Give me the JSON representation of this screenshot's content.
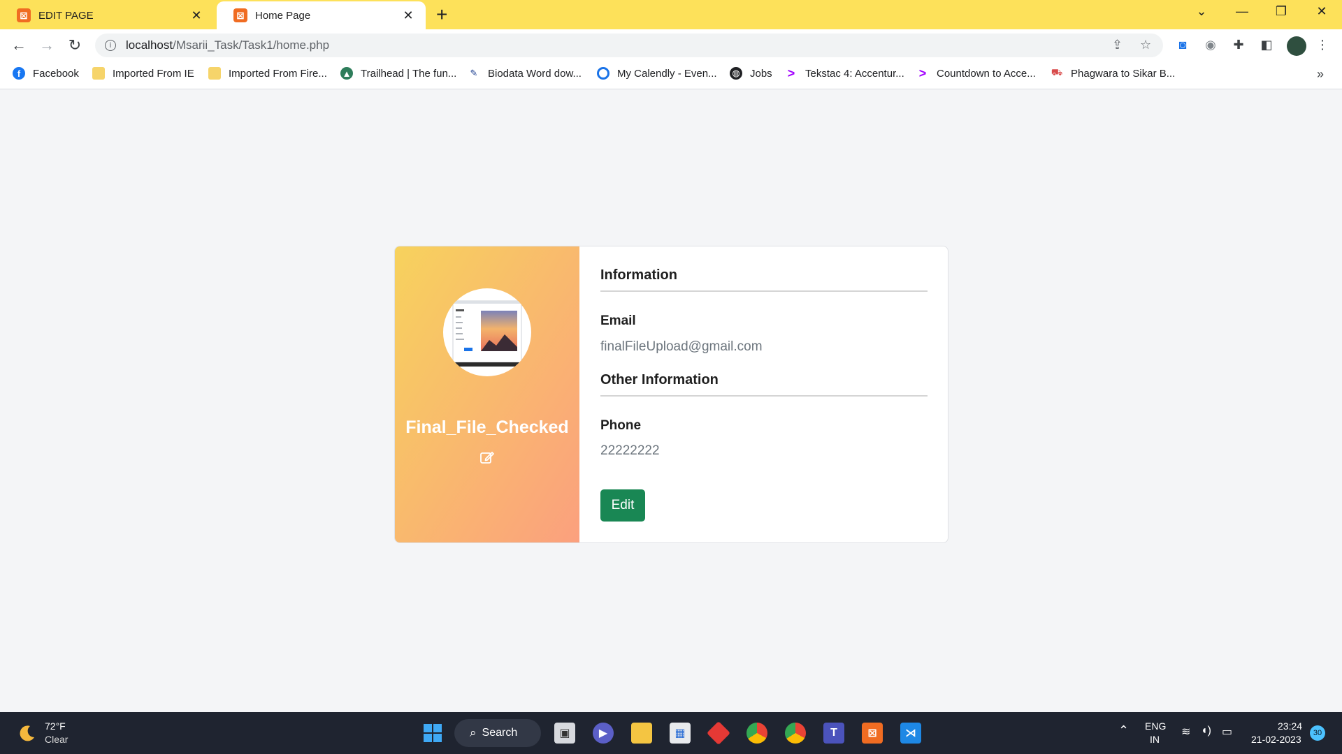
{
  "browser": {
    "tabs": [
      {
        "title": "EDIT PAGE",
        "favicon": "xampp-icon"
      },
      {
        "title": "Home Page",
        "favicon": "xampp-icon"
      }
    ],
    "new_tab_symbol": "+",
    "url_host": "localhost",
    "url_path": "/Msarii_Task/Task1/home.php",
    "accent_color": "#fde15a"
  },
  "bookmarks": [
    {
      "label": "Facebook",
      "icon": "facebook-icon"
    },
    {
      "label": "Imported From IE",
      "icon": "folder-icon"
    },
    {
      "label": "Imported From Fire...",
      "icon": "folder-icon"
    },
    {
      "label": "Trailhead | The fun...",
      "icon": "trailhead-icon"
    },
    {
      "label": "Biodata Word dow...",
      "icon": "pen-icon"
    },
    {
      "label": "My Calendly - Even...",
      "icon": "calendly-icon"
    },
    {
      "label": "Jobs",
      "icon": "globe-icon"
    },
    {
      "label": "Tekstac 4: Accentur...",
      "icon": "accenture-icon"
    },
    {
      "label": "Countdown to Acce...",
      "icon": "accenture-icon"
    },
    {
      "label": "Phagwara to Sikar B...",
      "icon": "bus-icon"
    }
  ],
  "profile_card": {
    "username": "Final_File_Checked",
    "section_information": "Information",
    "email_label": "Email",
    "email_value": "finalFileUpload@gmail.com",
    "section_other": "Other Information",
    "phone_label": "Phone",
    "phone_value": "22222222",
    "edit_button": "Edit",
    "button_color": "#198754",
    "gradient_colors": [
      "#f7d25d",
      "#fba07e"
    ]
  },
  "taskbar": {
    "weather_temp": "72°F",
    "weather_desc": "Clear",
    "search_label": "Search",
    "language": "ENG",
    "region": "IN",
    "time": "23:24",
    "date": "21-02-2023",
    "notification_count": "30"
  }
}
